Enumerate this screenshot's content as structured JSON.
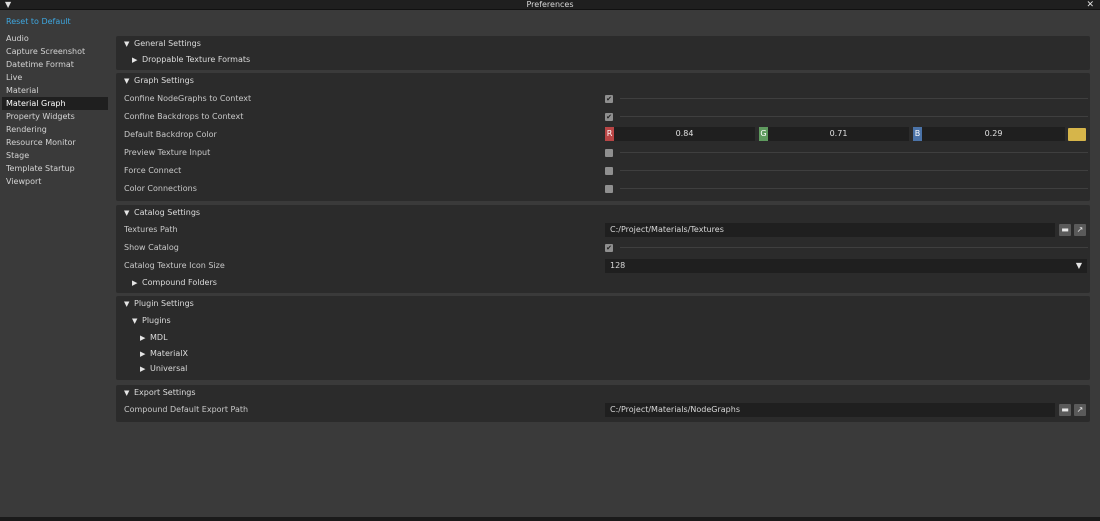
{
  "window": {
    "title": "Preferences"
  },
  "sidebar": {
    "reset_label": "Reset to Default",
    "items": [
      {
        "label": "Audio"
      },
      {
        "label": "Capture Screenshot"
      },
      {
        "label": "Datetime Format"
      },
      {
        "label": "Live"
      },
      {
        "label": "Material"
      },
      {
        "label": "Material Graph"
      },
      {
        "label": "Property Widgets"
      },
      {
        "label": "Rendering"
      },
      {
        "label": "Resource Monitor"
      },
      {
        "label": "Stage"
      },
      {
        "label": "Template Startup"
      },
      {
        "label": "Viewport"
      }
    ],
    "active": "Material Graph"
  },
  "general": {
    "title": "General Settings",
    "droppable": "Droppable Texture Formats"
  },
  "graph": {
    "title": "Graph Settings",
    "confine_nodegraphs": {
      "label": "Confine NodeGraphs to Context",
      "checked": true
    },
    "confine_backdrops": {
      "label": "Confine Backdrops to Context",
      "checked": true
    },
    "backdrop_color": {
      "label": "Default Backdrop Color",
      "r_tag": "R",
      "r": "0.84",
      "g_tag": "G",
      "g": "0.71",
      "b_tag": "B",
      "b": "0.29",
      "swatch": "#d6b54a"
    },
    "preview_texture": {
      "label": "Preview Texture Input",
      "checked": false
    },
    "force_connect": {
      "label": "Force Connect",
      "checked": false
    },
    "color_connections": {
      "label": "Color Connections",
      "checked": false
    }
  },
  "catalog": {
    "title": "Catalog Settings",
    "textures_path": {
      "label": "Textures Path",
      "value": "C:/Project/Materials/Textures"
    },
    "show_catalog": {
      "label": "Show Catalog",
      "checked": true
    },
    "icon_size": {
      "label": "Catalog Texture Icon Size",
      "value": "128"
    },
    "compound_folders": "Compound Folders"
  },
  "plugin": {
    "title": "Plugin Settings",
    "plugins": "Plugins",
    "items": [
      "MDL",
      "MaterialX",
      "Universal"
    ]
  },
  "export": {
    "title": "Export Settings",
    "compound_path": {
      "label": "Compound Default Export Path",
      "value": "C:/Project/Materials/NodeGraphs"
    }
  },
  "icons": {
    "folder": "folder-icon",
    "browse": "open-external-icon",
    "dropdown": "triangle-down-icon",
    "check": "check-icon"
  },
  "colors": {
    "link": "#3ea7e0",
    "r": "#b94545",
    "g": "#5e9a5e",
    "b": "#4b73a8"
  }
}
